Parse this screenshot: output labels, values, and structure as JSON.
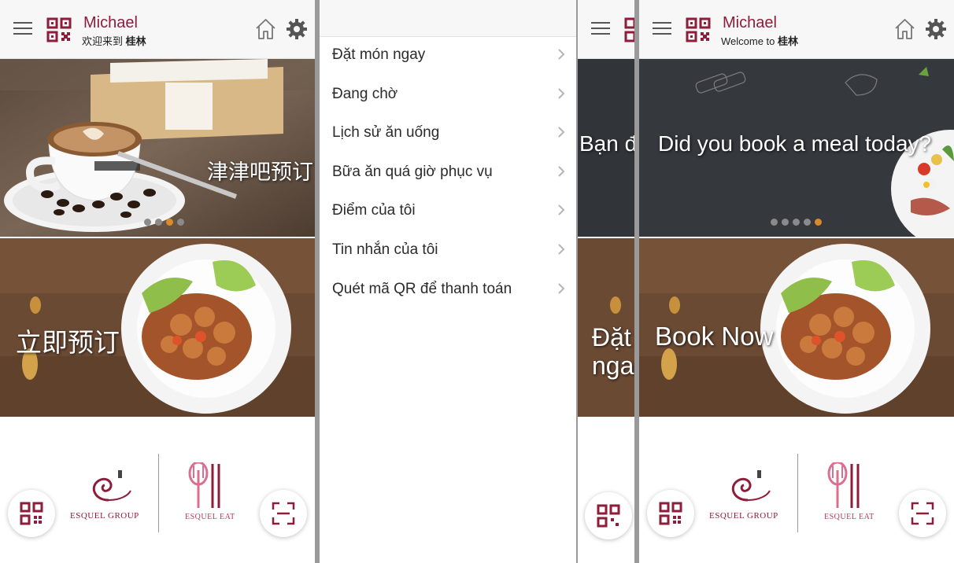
{
  "screens": {
    "left": {
      "user_name": "Michael",
      "welcome_prefix": "欢迎来到",
      "welcome_place": "桂林",
      "banner_top_text": "津津吧预订",
      "banner_mid_text": "立即预订",
      "carousel": {
        "count": 4,
        "active_index": 2
      },
      "brand_left_text": "ESQUEL GROUP",
      "brand_right_text": "ESQUEL EAT"
    },
    "menu": {
      "items": [
        {
          "label": "Đặt món ngay"
        },
        {
          "label": "Đang chờ"
        },
        {
          "label": "Lịch sử ăn uống"
        },
        {
          "label": "Bữa ăn quá giờ phục vụ"
        },
        {
          "label": "Điểm của tôi"
        },
        {
          "label": "Tin nhắn của tôi"
        },
        {
          "label": "Quét mã QR để thanh toán"
        }
      ]
    },
    "partial": {
      "banner_top_text": "Bạn đ",
      "banner_mid_line1": "Đặt",
      "banner_mid_line2": "nga"
    },
    "right": {
      "user_name": "Michael",
      "welcome_prefix": "Welcome to",
      "welcome_place": "桂林",
      "banner_top_text": "Did you book a meal today?",
      "banner_mid_text": "Book Now",
      "carousel": {
        "count": 5,
        "active_index": 4
      },
      "brand_left_text": "ESQUEL GROUP",
      "brand_right_text": "ESQUEL EAT"
    }
  },
  "icons": {
    "menu": "hamburger-icon",
    "qr": "qr-code-icon",
    "home": "home-icon",
    "settings": "gear-icon",
    "scan": "scan-icon",
    "chevron": "chevron-right-icon"
  },
  "colors": {
    "brand": "#8e1d3a",
    "header_bg": "#f7f7f7",
    "dot_active": "#d88a2c"
  }
}
